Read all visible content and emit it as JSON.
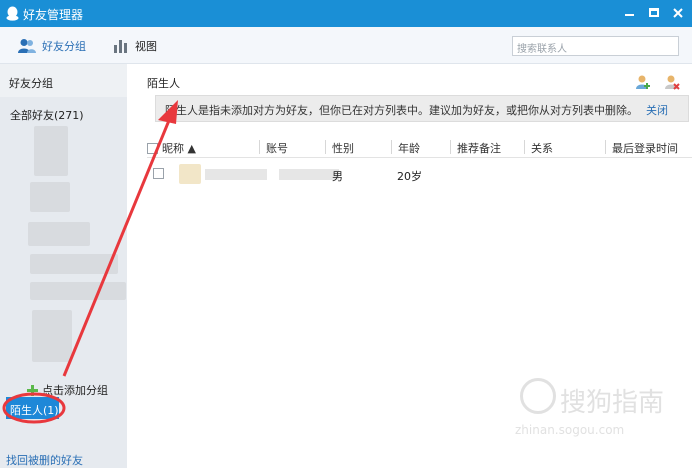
{
  "window": {
    "title": "好友管理器",
    "min_icon": "minimize-icon",
    "max_icon": "maximize-icon",
    "close_icon": "close-icon"
  },
  "toolbar": {
    "group_label": "好友分组",
    "view_label": "视图",
    "search_placeholder": "搜索联系人"
  },
  "sidebar": {
    "header": "好友分组",
    "all_friends": "全部好友(271)",
    "add_group": "点击添加分组",
    "stranger_group": "陌生人(1)",
    "recover_link": "找回被删的好友"
  },
  "main": {
    "title": "陌生人",
    "tip_text": "陌生人是指未添加对方为好友，但你已在对方列表中。建议加为好友，或把你从对方列表中删除。",
    "tip_close": "关闭",
    "columns": [
      "昵称 ▲",
      "账号",
      "性别",
      "年龄",
      "推荐备注",
      "关系",
      "最后登录时间"
    ],
    "rows": [
      {
        "gender": "男",
        "age": "20岁"
      }
    ]
  },
  "watermark": {
    "cn": "搜狗指南",
    "en": "zhinan.sogou.com"
  },
  "colors": {
    "titlebar": "#1a8fd6",
    "accent": "#1e88d8",
    "annotation": "#e8383d"
  }
}
